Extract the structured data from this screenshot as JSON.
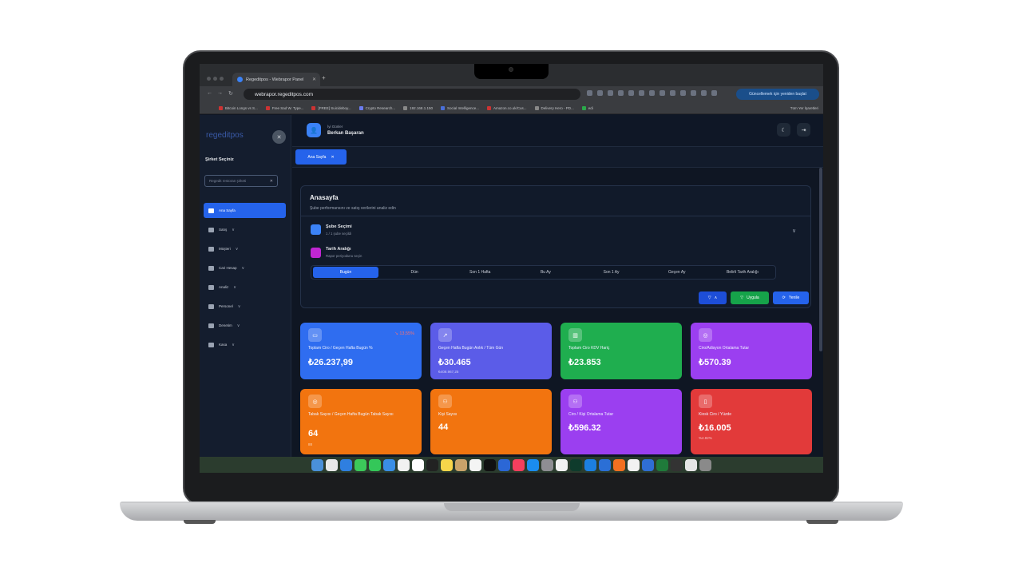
{
  "browser": {
    "tab_title": "Regeditpos - Webrapor Panel",
    "url": "webrapor.regeditpos.com",
    "update_button": "Güncellemek için yeniden başlat",
    "bookmarks": [
      "Bitcoin Longs vs S...",
      "Free Sad W. Type...",
      "[FREE] Suicideboy...",
      "Crypto Research...",
      "192.168.1.150",
      "Social Intelligence...",
      "Amazon.co.uk/Cus...",
      "Delivery Hero - PD...",
      "edi"
    ],
    "bookmarks_right": "Tüm Yer İşaretleri"
  },
  "sidebar": {
    "brand": "regeditpos",
    "company_title": "Şirket Seçiniz",
    "company_select": "Regedit restoran şirketi",
    "items": [
      {
        "label": "Ana Sayfa",
        "icon": "home-icon"
      },
      {
        "label": "Satış",
        "icon": "bag-icon"
      },
      {
        "label": "Müşteri",
        "icon": "users-icon"
      },
      {
        "label": "Cari Hesap",
        "icon": "account-icon"
      },
      {
        "label": "Analiz",
        "icon": "chart-icon"
      },
      {
        "label": "Personel",
        "icon": "staff-icon"
      },
      {
        "label": "Denetim",
        "icon": "shield-icon"
      },
      {
        "label": "Kasa",
        "icon": "register-icon"
      }
    ]
  },
  "topbar": {
    "greeting": "İyi Günler",
    "user_name": "Berkan Başaran"
  },
  "page_tab": "Ana Sayfa",
  "panel": {
    "title": "Anasayfa",
    "subtitle": "Şube performansını ve satış verilerini analiz edin",
    "branch_title": "Şube Seçimi",
    "branch_sub": "1 / 1 şube seçildi",
    "date_title": "Tarih Aralığı",
    "date_sub": "Rapor periyodunu seçin",
    "periods": [
      "Bugün",
      "Dün",
      "Son 1 Hafta",
      "Bu Ay",
      "Son 1 Ay",
      "Geçen Ay",
      "Belirli Tarih Aralığı"
    ],
    "apply": "Uygula",
    "refresh": "Yenile"
  },
  "cards": [
    {
      "label": "Toplam Ciro / Geçen Hafta Bugün %",
      "value": "₺26.237,99",
      "sub": "",
      "badge": "↘ 13,55%",
      "color": "#2f6df0"
    },
    {
      "label": "Geçen Hafta Bugün Anlık / Tüm Gün",
      "value": "₺30.465",
      "sub": "₺408.967,25",
      "badge": "",
      "color": "#5b5ce8"
    },
    {
      "label": "Toplam Ciro KDV Hariç",
      "value": "₺23.853",
      "sub": "",
      "badge": "",
      "color": "#1fae4f"
    },
    {
      "label": "Ciro/Adisyon Ortalama Tutar",
      "value": "₺570.39",
      "sub": "",
      "badge": "",
      "color": "#9b3ff0"
    },
    {
      "label": "Tabak Sayısı / Geçen Hafta Bugün Tabak Sayısı",
      "value": "64",
      "sub": "88",
      "badge": "",
      "color": "#f2740f"
    },
    {
      "label": "Kişi Sayısı",
      "value": "44",
      "sub": "",
      "badge": "",
      "color": "#f2740f"
    },
    {
      "label": "Ciro / Kişi Ortalama Tutar",
      "value": "₺596.32",
      "sub": "",
      "badge": "",
      "color": "#9b3ff0"
    },
    {
      "label": "Kiosk Ciro / Yüzde",
      "value": "₺16.005",
      "sub": "%4.82%",
      "badge": "",
      "color": "#e23a3a"
    }
  ]
}
